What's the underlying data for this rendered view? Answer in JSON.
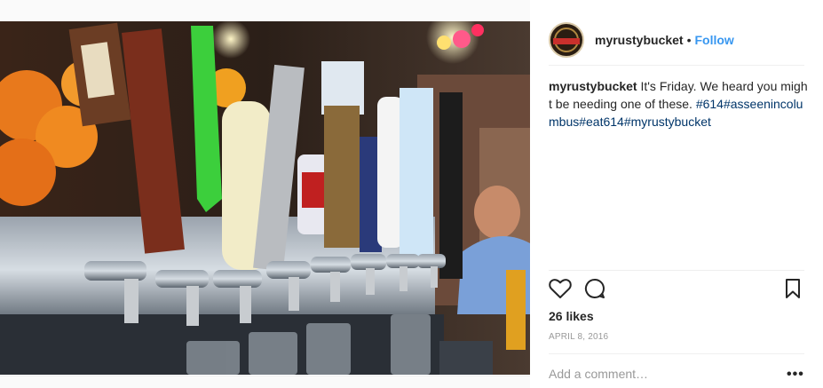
{
  "post": {
    "username": "myrustybucket",
    "separator": "•",
    "follow_label": "Follow",
    "caption_username": "myrustybucket",
    "caption_text": " It's Friday. We heard you might be needing one of these.",
    "caption_tags": "#614#asseenincolumbus#eat614#myrustybucket",
    "likes": "26 likes",
    "date": "APRIL 8, 2016",
    "comment_placeholder": "Add a comment…",
    "more_label": "•••"
  },
  "icons": {
    "like": "heart-icon",
    "comment": "comment-icon",
    "save": "bookmark-icon"
  },
  "colors": {
    "link": "#3897f0",
    "hashtag": "#003569",
    "muted": "#999999"
  }
}
